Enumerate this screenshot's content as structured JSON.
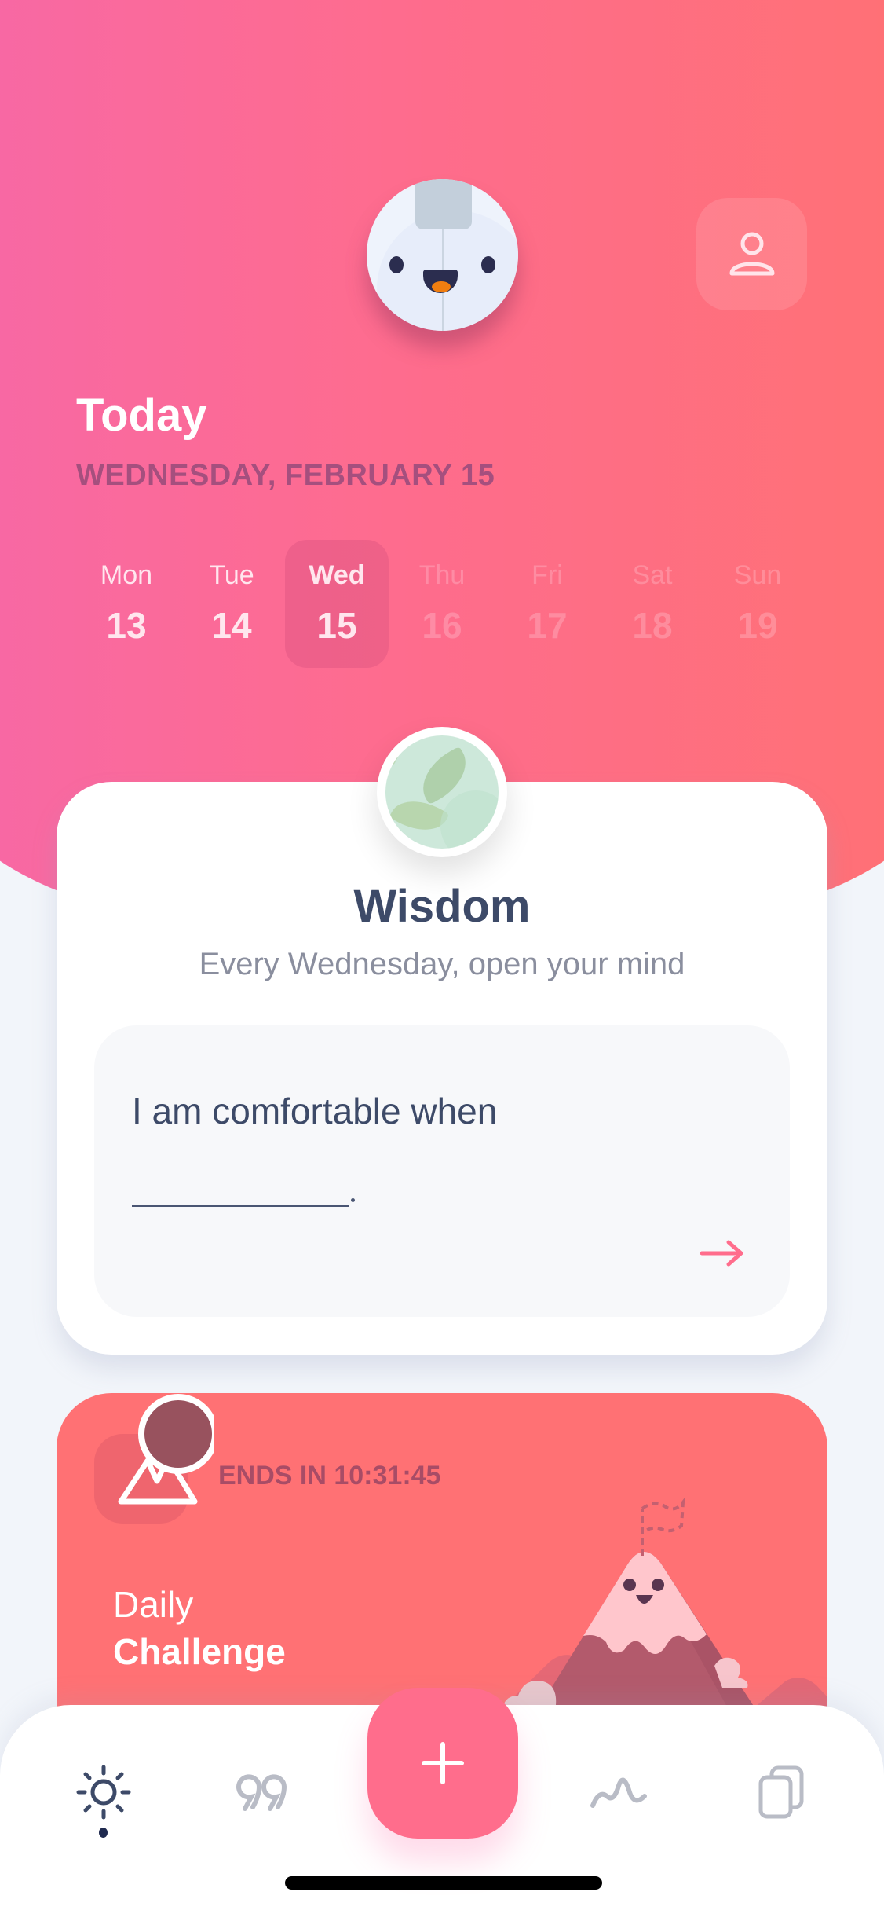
{
  "header": {
    "title": "Today",
    "date": "WEDNESDAY, FEBRUARY 15",
    "profile_icon": "person-icon",
    "mascot": "smiling-egg-mascot"
  },
  "week": {
    "days": [
      {
        "name": "Mon",
        "num": "13",
        "state": "past"
      },
      {
        "name": "Tue",
        "num": "14",
        "state": "past"
      },
      {
        "name": "Wed",
        "num": "15",
        "state": "selected"
      },
      {
        "name": "Thu",
        "num": "16",
        "state": "future"
      },
      {
        "name": "Fri",
        "num": "17",
        "state": "future"
      },
      {
        "name": "Sat",
        "num": "18",
        "state": "future"
      },
      {
        "name": "Sun",
        "num": "19",
        "state": "future"
      }
    ]
  },
  "wisdom": {
    "badge_icon": "leaves-icon",
    "title": "Wisdom",
    "subtitle": "Every Wednesday, open your mind",
    "prompt": "I am comfortable when",
    "blank_suffix": ".",
    "submit_icon": "arrow-right-icon"
  },
  "challenge": {
    "ends_in": "ENDS IN 10:31:45",
    "label_line1": "Daily",
    "label_line2": "Challenge",
    "icon": "mountain-icon"
  },
  "nav": {
    "items": [
      {
        "icon": "sun-icon",
        "active": true
      },
      {
        "icon": "quote-icon",
        "active": false
      },
      {
        "icon": "plus-icon",
        "active": false
      },
      {
        "icon": "wave-icon",
        "active": false
      },
      {
        "icon": "cards-icon",
        "active": false
      }
    ]
  },
  "colors": {
    "gradient_start": "#F768A6",
    "gradient_end": "#FF7174",
    "accent": "#FF6D8C",
    "text_dark": "#3D4A68",
    "challenge_bg": "#FF7174",
    "page_bg": "#F2F5FA"
  }
}
